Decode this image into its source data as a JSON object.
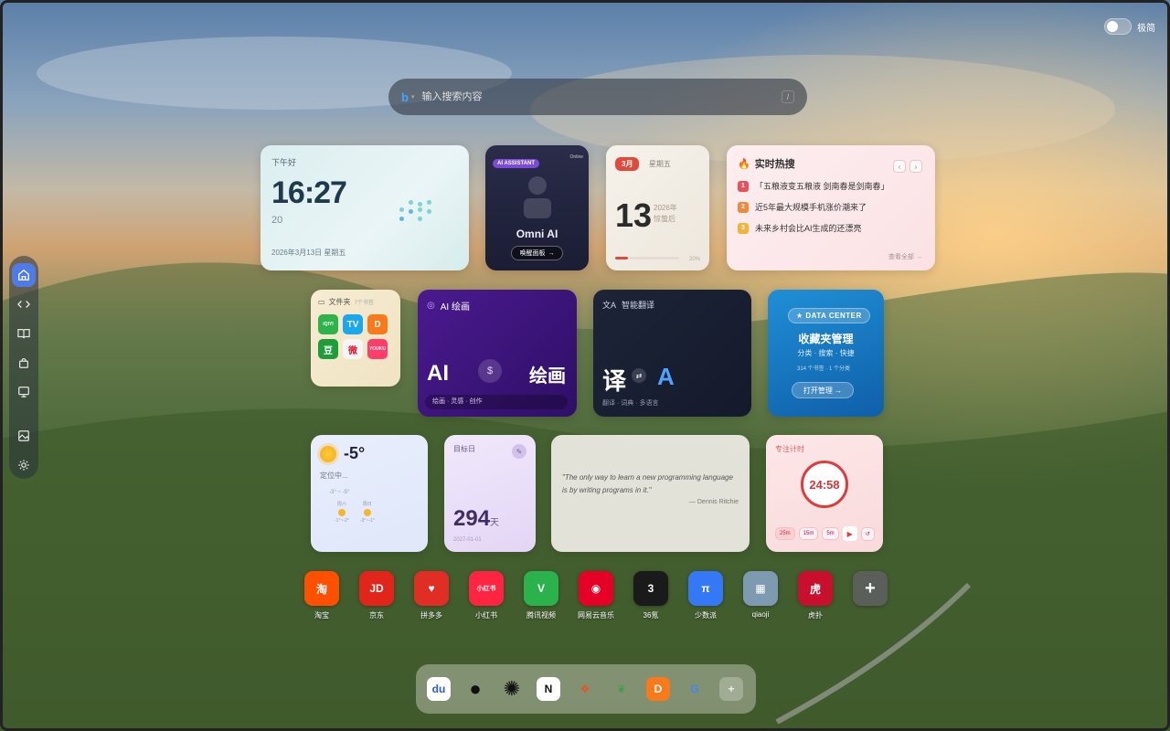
{
  "top_right": {
    "toggle_label": "极简"
  },
  "sidebar": {
    "items": [
      {
        "name": "home-icon"
      },
      {
        "name": "code-icon"
      },
      {
        "name": "book-icon"
      },
      {
        "name": "bag-icon"
      },
      {
        "name": "monitor-icon"
      },
      {
        "name": "image-icon"
      },
      {
        "name": "gear-icon"
      }
    ]
  },
  "search": {
    "placeholder": "输入搜索内容",
    "shortcut": "/"
  },
  "clock": {
    "greeting": "下午好",
    "time": "16:27",
    "seconds": "20",
    "date": "2026年3月13日 星期五"
  },
  "ai_assistant": {
    "badge": "AI ASSISTANT",
    "status": "Online",
    "name": "Omni AI",
    "button": "唤醒面板"
  },
  "calendar": {
    "month": "3月",
    "weekday": "星期五",
    "day": "13",
    "year": "2026年",
    "festival": "惊蛰后",
    "progress": 0.2,
    "progress_label": "20%"
  },
  "hot": {
    "title": "实时热搜",
    "more": "查看全部 →",
    "items": [
      {
        "rank": "1",
        "text": "「五粮液变五粮液 剑南春是剑南春」",
        "color": "#e8505b"
      },
      {
        "rank": "2",
        "text": "近5年最大规模手机涨价潮来了",
        "color": "#f08a3a"
      },
      {
        "rank": "3",
        "text": "未来乡村会比AI生成的还漂亮",
        "color": "#f2b33a"
      }
    ]
  },
  "folder": {
    "title": "文件夹",
    "count": "7个书签",
    "apps": [
      {
        "label": "iQIYI",
        "color": "#2fb24c"
      },
      {
        "label": "TV",
        "color": "#1aa7ec"
      },
      {
        "label": "D",
        "color": "#f97a1a"
      },
      {
        "label": "豆",
        "color": "#1e9d3a"
      },
      {
        "label": "微",
        "color": "#f5f5f5"
      },
      {
        "label": "YOUKU",
        "color": "#ff3d6b"
      }
    ]
  },
  "ai_draw": {
    "title": "AI 绘画",
    "left": "AI",
    "coin": "$",
    "right": "绘画",
    "tags": "绘画 · 灵感 · 创作"
  },
  "translate": {
    "title": "智能翻译",
    "zh": "译",
    "swap": "⇄",
    "en": "A",
    "tags": "翻译 · 词典 · 多语言"
  },
  "data_center": {
    "badge": "★ DATA CENTER",
    "title": "收藏夹管理",
    "subtitle": "分类 · 搜索 · 快捷",
    "meta": "314 个书签 · 1 个分类",
    "button": "打开管理 →"
  },
  "weather": {
    "temp": "-5°",
    "location": "定位中...",
    "range": "-3° ~ -5°",
    "days": [
      {
        "name": "周六",
        "range": "-1°~-2°"
      },
      {
        "name": "周日",
        "range": "-3°~-1°"
      }
    ]
  },
  "target": {
    "label": "目标日",
    "days": "294",
    "unit": "天",
    "date": "2027-01-01"
  },
  "quote": {
    "text": "\"The only way to learn a new programming language is by writing programs in it.\"",
    "author": "— Dennis Ritchie"
  },
  "focus": {
    "title": "专注计时",
    "time": "24:58",
    "presets": [
      "25m",
      "15m",
      "5m"
    ]
  },
  "apps": [
    {
      "label": "淘宝",
      "glyph": "淘",
      "color": "#ff5000"
    },
    {
      "label": "京东",
      "glyph": "JD",
      "color": "#e1251b"
    },
    {
      "label": "拼多多",
      "glyph": "♥",
      "color": "#e02e24"
    },
    {
      "label": "小红书",
      "glyph": "小红书",
      "color": "#ff2442"
    },
    {
      "label": "腾讯视频",
      "glyph": "V",
      "color": "#2bb24c"
    },
    {
      "label": "网易云音乐",
      "glyph": "◉",
      "color": "#e60026"
    },
    {
      "label": "36氪",
      "glyph": "3",
      "color": "#1a1a1a"
    },
    {
      "label": "少数派",
      "glyph": "π",
      "color": "#3478f6"
    },
    {
      "label": "qiaoji",
      "glyph": "▦",
      "color": "#7e9ab0"
    },
    {
      "label": "虎扑",
      "glyph": "虎",
      "color": "#c8102e"
    },
    {
      "label": "",
      "glyph": "+",
      "color": "#5a5f5a"
    }
  ],
  "dock": [
    {
      "name": "baidu-icon",
      "glyph": "du",
      "color": "#2a5ae8",
      "bg": "#ffffff"
    },
    {
      "name": "github-icon",
      "glyph": "●",
      "color": "#111",
      "bg": "transparent"
    },
    {
      "name": "openai-icon",
      "glyph": "✺",
      "color": "#111",
      "bg": "transparent"
    },
    {
      "name": "notion-icon",
      "glyph": "N",
      "color": "#111",
      "bg": "#ffffff"
    },
    {
      "name": "figma-icon",
      "glyph": "❖",
      "color": "#f24e1e",
      "bg": "transparent"
    },
    {
      "name": "leaf-icon",
      "glyph": "❦",
      "color": "#3aa047",
      "bg": "transparent"
    },
    {
      "name": "dopamine-icon",
      "glyph": "D",
      "color": "#ffffff",
      "bg": "#f97a1a"
    },
    {
      "name": "google-icon",
      "glyph": "G",
      "color": "#4285f4",
      "bg": "transparent"
    },
    {
      "name": "add-icon",
      "glyph": "+",
      "color": "#eee",
      "bg": "rgba(255,255,255,.25)"
    }
  ]
}
